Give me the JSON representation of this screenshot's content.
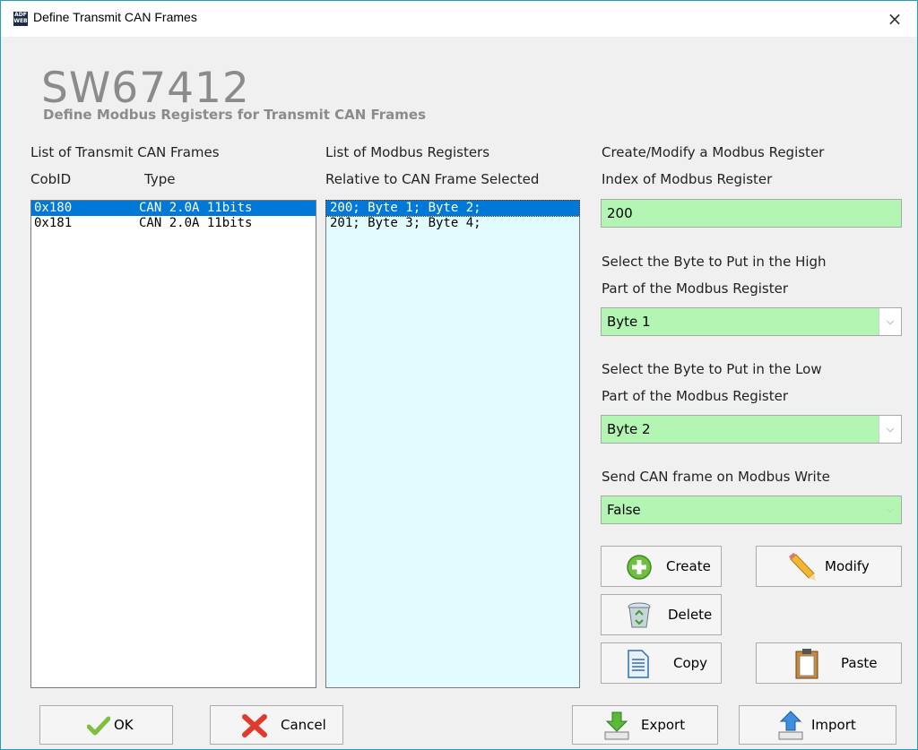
{
  "window": {
    "title": "Define Transmit CAN Frames",
    "close_glyph": "×",
    "icon_text": "ADF WEB"
  },
  "header": {
    "title": "SW67412",
    "subtitle": "Define Modbus Registers for Transmit CAN Frames"
  },
  "frames_panel": {
    "title": "List of Transmit CAN Frames",
    "col_cobid": "CobID",
    "col_type": "Type",
    "rows": [
      {
        "cobid": "0x180",
        "type": "CAN 2.0A 11bits",
        "selected": true
      },
      {
        "cobid": "0x181",
        "type": "CAN 2.0A 11bits",
        "selected": false
      }
    ]
  },
  "regs_panel": {
    "title": "List of Modbus Registers",
    "subtitle": "Relative to CAN Frame Selected",
    "rows": [
      {
        "text": "200; Byte 1; Byte 2;",
        "selected": true
      },
      {
        "text": "201; Byte 3; Byte 4;",
        "selected": false
      }
    ]
  },
  "editor": {
    "title": "Create/Modify a Modbus Register",
    "index_label": "Index of Modbus Register",
    "index_value": "200",
    "high_label_1": "Select the Byte to Put in the High",
    "high_label_2": "Part of the Modbus Register",
    "high_value": "Byte 1",
    "low_label_1": "Select the Byte to Put in the Low",
    "low_label_2": "Part of the Modbus Register",
    "low_value": "Byte 2",
    "send_label": "Send CAN frame on Modbus Write",
    "send_value": "False"
  },
  "buttons": {
    "create": "Create",
    "modify": "Modify",
    "delete": "Delete",
    "copy": "Copy",
    "paste": "Paste",
    "ok": "OK",
    "cancel": "Cancel",
    "export": "Export",
    "import": "Import"
  },
  "colors": {
    "field_green": "#b3f5b3",
    "list_selection": "#0078d7",
    "regs_list_bg": "#e2fbff",
    "title_gray": "#8b8b8b"
  },
  "icons": {
    "create": "plus-circle-icon",
    "modify": "pencil-icon",
    "delete": "recycle-bin-icon",
    "copy": "document-icon",
    "paste": "clipboard-icon",
    "ok": "checkmark-icon",
    "cancel": "red-x-icon",
    "export": "export-arrow-down-icon",
    "import": "import-arrow-up-icon"
  }
}
